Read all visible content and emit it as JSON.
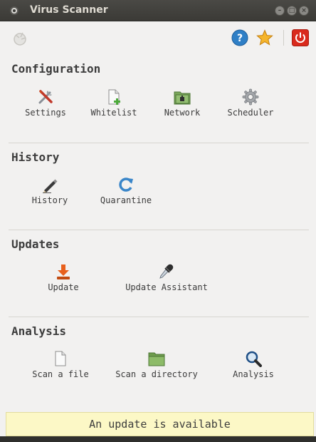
{
  "window": {
    "title": "Virus Scanner",
    "controls": {
      "minimize": "–",
      "maximize": "□",
      "close": "×"
    }
  },
  "toolbar": {
    "left_icon": "scanner-logo-icon",
    "help_icon": "help-icon",
    "favorite_icon": "star-icon",
    "quit_icon": "power-icon"
  },
  "sections": {
    "configuration": {
      "title": "Configuration",
      "items": [
        {
          "label": "Settings",
          "icon": "settings-tools-icon"
        },
        {
          "label": "Whitelist",
          "icon": "whitelist-document-icon"
        },
        {
          "label": "Network",
          "icon": "network-folder-icon"
        },
        {
          "label": "Scheduler",
          "icon": "gear-icon"
        }
      ]
    },
    "history": {
      "title": "History",
      "items": [
        {
          "label": "History",
          "icon": "pencil-icon"
        },
        {
          "label": "Quarantine",
          "icon": "refresh-icon"
        }
      ]
    },
    "updates": {
      "title": "Updates",
      "items": [
        {
          "label": "Update",
          "icon": "download-icon"
        },
        {
          "label": "Update Assistant",
          "icon": "dropper-icon"
        }
      ]
    },
    "analysis": {
      "title": "Analysis",
      "items": [
        {
          "label": "Scan a file",
          "icon": "file-icon"
        },
        {
          "label": "Scan a directory",
          "icon": "folder-icon"
        },
        {
          "label": "Analysis",
          "icon": "magnifier-icon"
        }
      ]
    }
  },
  "notification": {
    "text": "An update is available"
  },
  "colors": {
    "titlebar": "#3b3a36",
    "background": "#f2f1f0",
    "notice_bg": "#fcf8c6",
    "help_blue": "#2f7fc6",
    "star_orange": "#f0a020",
    "power_red": "#d92a1c"
  }
}
